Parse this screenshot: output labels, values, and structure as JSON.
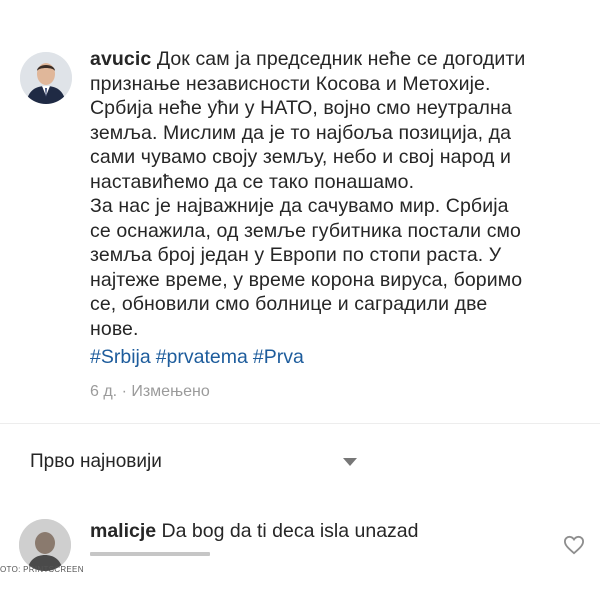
{
  "post": {
    "username": "avucic",
    "text": " Док сам ја председник неће се догодити\nпризнање независности Косова и Метохије.\nСрбија неће ући у НАТО, војно смо неутрална\nземља. Мислим да је то најбоља позиција, да\nсами чувамо своју земљу, небо и свој народ и\nнаставићемо да се тако понашамо.\nЗа нас је најважније да сачувамо мир. Србија\nсе оснажила, од земље губитника постали смо\nземља број један у Европи по стопи раста. У\nнајтеже време, у време корона вируса, боримо\nсе, обновили смо болнице и саградили две\nнове.",
    "hashtags": [
      "#Srbija",
      "#prvatema",
      "#Prva"
    ],
    "meta": "6 д. · Измењено"
  },
  "comments_sort": {
    "label": "Прво најновији"
  },
  "comment": {
    "username": "malicje",
    "text": " Da bog da ti deca isla unazad"
  },
  "photo_credit": "OTO: PRINTSCREEN",
  "icons": {
    "sort": "chevron-down-icon",
    "like": "heart-icon"
  },
  "colors": {
    "hashtag": "#1d5c9c",
    "meta": "#9b9b9b",
    "text": "#262626"
  }
}
